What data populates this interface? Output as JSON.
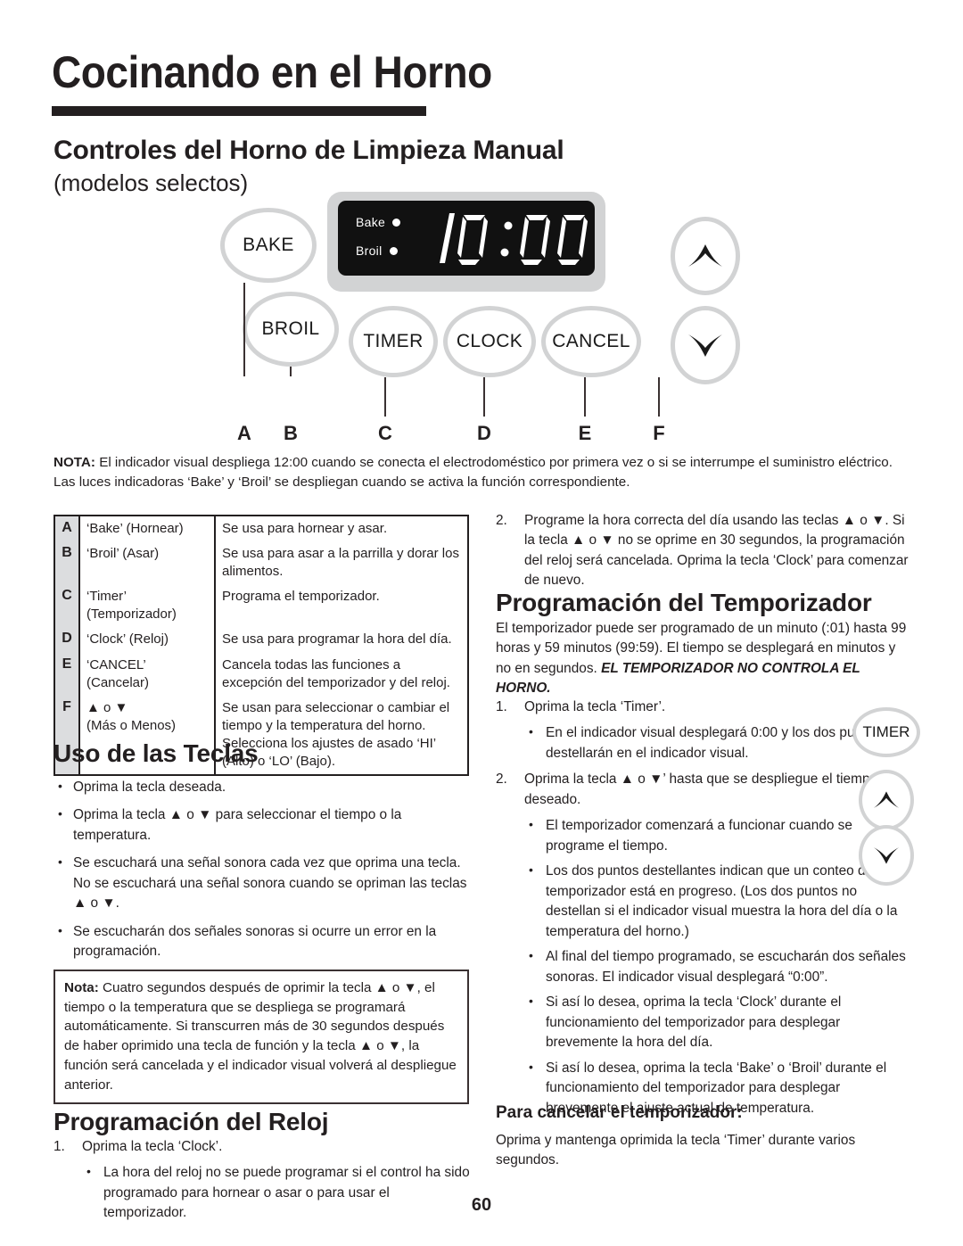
{
  "page": {
    "title": "Cocinando en el Horno",
    "subtitle": "Controles del Horno de Limpieza Manual",
    "subtitle_note": "(modelos selectos)",
    "page_number": "60"
  },
  "diagram": {
    "buttons": [
      {
        "label": "BAKE",
        "letter": "A"
      },
      {
        "label": "BROIL",
        "letter": "B"
      },
      {
        "label": "TIMER",
        "letter": "C"
      },
      {
        "label": "CLOCK",
        "letter": "D"
      },
      {
        "label": "CANCEL",
        "letter": "E"
      },
      {
        "label": "up-down-arrows",
        "letter": "F"
      }
    ],
    "letters": [
      "A",
      "B",
      "C",
      "D",
      "E",
      "F"
    ],
    "display": {
      "time": "10:00",
      "indicator_bake": "Bake",
      "indicator_broil": "Broil"
    }
  },
  "nota_top": {
    "label": "NOTA:",
    "text": " El indicador visual despliega 12:00 cuando se conecta el electrodoméstico por primera vez o si se interrumpe el suministro eléctrico. Las luces indicadoras ‘Bake’ y ‘Broil’ se despliegan cuando se activa la función correspondiente."
  },
  "legend": {
    "rows": [
      {
        "letter": "A",
        "name": "‘Bake’ (Hornear)",
        "desc": "Se usa para hornear y asar."
      },
      {
        "letter": "B",
        "name": "‘Broil’ (Asar)",
        "desc": "Se usa para asar a la parrilla y dorar los alimentos."
      },
      {
        "letter": "C",
        "name": "‘Timer’ (Temporizador)",
        "desc": "Programa el temporizador."
      },
      {
        "letter": "D",
        "name": "‘Clock’ (Reloj)",
        "desc": "Se usa para programar la hora del día."
      },
      {
        "letter": "E",
        "name": "‘CANCEL’ (Cancelar)",
        "desc": "Cancela todas las funciones a excepción del temporizador y del reloj."
      },
      {
        "letter": "F",
        "name": "▲ o ▼\n(Más o Menos)",
        "name_line1": "▲ o ▼",
        "name_line2": "(Más o Menos)",
        "desc": "Se usan para seleccionar o cambiar el tiempo y la temperatura del horno. Selecciona los ajustes de asado ‘HI’ (Alto) o ‘LO’ (Bajo)."
      }
    ]
  },
  "uso_teclas": {
    "heading": "Uso de las Teclas",
    "bullets": [
      "Oprima la tecla deseada.",
      "Oprima la tecla ▲ o ▼ para seleccionar el tiempo o la temperatura.",
      "Se escuchará una señal sonora cada vez que oprima una tecla. No se escuchará una señal sonora cuando se opriman las teclas ▲ o ▼.",
      "Se escucharán dos señales sonoras si ocurre un error en la programación."
    ]
  },
  "nota_box": {
    "label": "Nota:",
    "text": " Cuatro segundos después de oprimir la tecla ▲ o ▼, el tiempo o la temperatura que se despliega se programará automáticamente. Si transcurren más de 30 segundos después de haber oprimido una tecla de función y la tecla ▲ o ▼, la función será cancelada y el indicador visual volverá al despliegue anterior."
  },
  "programacion_reloj": {
    "heading": "Programación del Reloj",
    "step1_num": "1.",
    "step1_text": "Oprima la tecla ‘Clock’.",
    "step1_bullets": [
      "La hora del reloj no se puede programar si el control ha sido programado para hornear o asar o para usar el temporizador."
    ],
    "step2_num": "2.",
    "step2_text": "Programe la hora correcta del día usando las teclas ▲ o ▼. Si la tecla ▲ o ▼ no se oprime en 30 segundos, la programación del reloj será cancelada. Oprima la tecla ‘Clock’ para comenzar de nuevo."
  },
  "programacion_temporizador": {
    "heading": "Programación del Temporizador",
    "intro_plain": "El temporizador puede ser programado de un minuto (:01) hasta 99 horas y 59 minutos (99:59). El tiempo se desplegará en minutos y no en segundos. ",
    "intro_emphasis": "EL TEMPORIZADOR NO CONTROLA EL HORNO.",
    "step1_num": "1.",
    "step1_text": "Oprima la tecla ‘Timer’.",
    "step1_bullets": [
      "En el indicador visual desplegará 0:00 y los dos puntos (:) destellarán en el indicador visual."
    ],
    "step2_num": "2.",
    "step2_text": "Oprima la tecla ▲ o ▼’ hasta que se despliegue el tiempo deseado.",
    "step2_bullets": [
      "El temporizador comenzará a funcionar cuando se programe el tiempo.",
      "Los dos puntos destellantes indican que un conteo del temporizador está en progreso. (Los dos puntos no destellan si el indicador visual muestra la hora del día o la temperatura del horno.)",
      "Al final del tiempo programado, se escucharán dos señales sonoras. El indicador visual desplegará “0:00”.",
      "Si así lo desea, oprima la tecla ‘Clock’ durante el funcionamiento del temporizador para desplegar brevemente la hora del día.",
      "Si así lo desea, oprima la tecla ‘Bake’ o ‘Broil’ durante el funcionamiento del temporizador para desplegar brevemente el ajuste actual de temperatura."
    ],
    "mini_timer_label": "TIMER"
  },
  "cancelar": {
    "heading": "Para cancelar el temporizador:",
    "text": "Oprima y mantenga oprimida la tecla ‘Timer’ durante varios segundos."
  },
  "colors": {
    "ink": "#231f20",
    "button_gray": "#d2d3d4",
    "display_black": "#111111",
    "table_header_gray": "#dcdddf"
  }
}
